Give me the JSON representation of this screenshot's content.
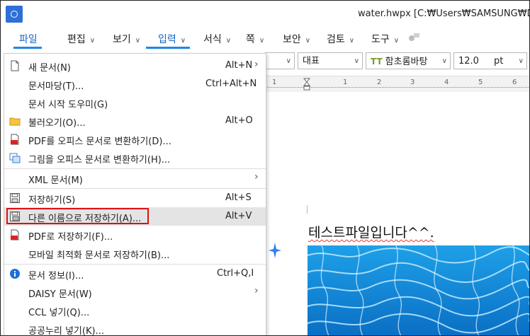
{
  "window": {
    "title": "water.hwpx [C:₩Users₩SAMSUNG₩Desk"
  },
  "menubar": {
    "items": [
      {
        "id": "file",
        "label": "파일",
        "chevron": false,
        "active": true
      },
      {
        "id": "edit",
        "label": "편집",
        "chevron": true
      },
      {
        "id": "view",
        "label": "보기",
        "chevron": true
      },
      {
        "id": "input",
        "label": "입력",
        "chevron": true,
        "active": true
      },
      {
        "id": "format",
        "label": "서식",
        "chevron": true
      },
      {
        "id": "page",
        "label": "쪽",
        "chevron": true
      },
      {
        "id": "security",
        "label": "보안",
        "chevron": true
      },
      {
        "id": "review",
        "label": "검토",
        "chevron": true
      },
      {
        "id": "tools",
        "label": "도구",
        "chevron": true
      }
    ]
  },
  "toolbar": {
    "style_combo": "",
    "style_value": "대표",
    "font_icon": "TT",
    "font_value": "함초롬바탕",
    "size_value": "12.0",
    "size_unit": "pt"
  },
  "ruler": {
    "ticks": [
      "1",
      "1",
      "2",
      "3",
      "4",
      "5",
      "6"
    ]
  },
  "document": {
    "text": "테스트파일입니다^^."
  },
  "file_menu": {
    "items": [
      {
        "icon": "new-document-icon",
        "label": "새 문서(N)",
        "shortcut": "Alt+N",
        "submenu": true
      },
      {
        "icon": "",
        "label": "문서마당(T)...",
        "shortcut": "Ctrl+Alt+N",
        "submenu": false
      },
      {
        "icon": "",
        "label": "문서 시작 도우미(G)",
        "shortcut": "",
        "submenu": false
      },
      {
        "icon": "folder-icon",
        "label": "불러오기(O)...",
        "shortcut": "Alt+O",
        "submenu": false
      },
      {
        "icon": "pdf-convert-icon",
        "label": "PDF를 오피스 문서로 변환하기(D)...",
        "shortcut": "",
        "submenu": false
      },
      {
        "icon": "image-convert-icon",
        "label": "그림을 오피스 문서로 변환하기(H)...",
        "shortcut": "",
        "submenu": false
      },
      {
        "icon": "",
        "label": "XML 문서(M)",
        "shortcut": "",
        "submenu": true
      },
      {
        "icon": "save-icon",
        "label": "저장하기(S)",
        "shortcut": "Alt+S",
        "submenu": false
      },
      {
        "icon": "save-as-icon",
        "label": "다른 이름으로 저장하기(A)...",
        "shortcut": "Alt+V",
        "submenu": false,
        "highlighted": true
      },
      {
        "icon": "pdf-save-icon",
        "label": "PDF로 저장하기(F)...",
        "shortcut": "",
        "submenu": false
      },
      {
        "icon": "",
        "label": "모바일 최적화 문서로 저장하기(B)...",
        "shortcut": "",
        "submenu": false
      },
      {
        "icon": "info-icon",
        "label": "문서 정보(I)...",
        "shortcut": "Ctrl+Q,I",
        "submenu": false
      },
      {
        "icon": "",
        "label": "DAISY 문서(W)",
        "shortcut": "",
        "submenu": true
      },
      {
        "icon": "",
        "label": "CCL 넣기(Q)...",
        "shortcut": "",
        "submenu": false
      },
      {
        "icon": "",
        "label": "공공누리 넣기(K)...",
        "shortcut": "",
        "submenu": false
      }
    ]
  },
  "colors": {
    "accent": "#1e88e5",
    "highlight_box": "#e01010",
    "menu_hover": "#e4e4e4"
  }
}
